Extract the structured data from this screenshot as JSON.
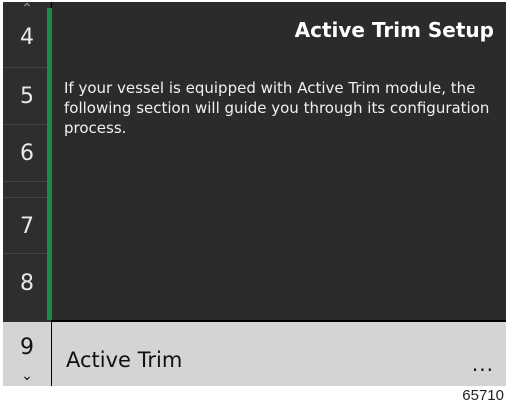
{
  "rail": {
    "scroll_up_icon": "chevron-up-icon",
    "scroll_down_icon": "chevron-down-icon",
    "steps": [
      "4",
      "5",
      "6",
      "7",
      "8",
      "9"
    ],
    "selected_step": "9"
  },
  "panel": {
    "title": "Active Trim Setup",
    "body": "If your vessel is equipped with Active Trim module, the following section will guide you through its configuration process."
  },
  "footer": {
    "label": "Active Trim",
    "more": "..."
  },
  "figure_number": "65710",
  "colors": {
    "background": "#2b2b2b",
    "rail": "#2e2e2e",
    "selection": "#d4d4d4",
    "progress_accent": "#1e8a4a"
  }
}
